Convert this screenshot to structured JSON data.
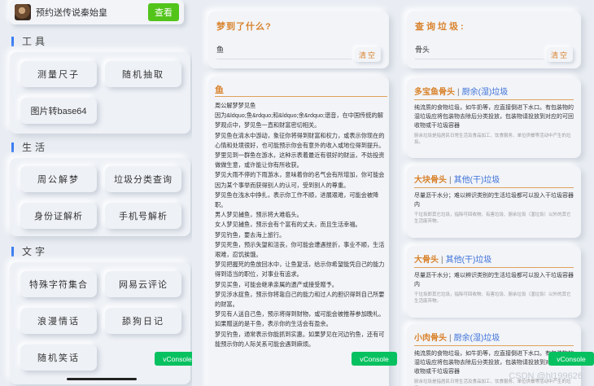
{
  "promo": {
    "text": "预约送传说秦始皇",
    "button": "查看"
  },
  "sections": [
    {
      "title": "工具",
      "items": [
        "测量尺子",
        "随机抽取",
        "图片转base64"
      ]
    },
    {
      "title": "生活",
      "items": [
        "周公解梦",
        "垃圾分类查询",
        "身份证解析",
        "手机号解析"
      ]
    },
    {
      "title": "文字",
      "items": [
        "特殊字符集合",
        "网易云评论",
        "浪漫情话",
        "舔狗日记",
        "随机笑话"
      ]
    }
  ],
  "dream": {
    "title": "梦到了什么?",
    "query": "鱼",
    "clear": "清空",
    "result_title": "鱼",
    "paragraphs": [
      "周公解梦梦见鱼",
      "因为&ldquo;鱼&rdquo;和&ldquo;余&rdquo;谐音，在中国传统的解梦观点中，梦见鱼一直和财富密切相关。",
      "梦见鱼在清水中游动，象征你将得到财富和权力，或表示你现在的心情和处境很好，也可能预示你会有意外的收入或地位得到提升。",
      "梦里见到一群鱼在游水，这种示表着最近有很好的财运，不妨投资做做生意，或许能让你有所收获。",
      "梦见大雨不停的下雨游水，意味着你的名气会有所增加，你可能会因为某个事举而获得别人的认可，受到别人的尊重。",
      "梦见鱼在浅水中挣扎，表示你工作不顺，进展艰难，可能会被降职。",
      "男人梦见捕鱼，预示将大难临头。",
      "女人梦见捕鱼，预示会有个富有的丈夫，而且生活幸福。",
      "梦见钓鱼，要去海上旅行。",
      "梦见死鱼，预示失望和沮丧，你可能会遭遇挫折，事业不顺，生活艰难，忍饥挨饿。",
      "梦见把握死的鱼放回水中，让鱼复活，给示你希望能凭自己的能力得到适当的职位，对事业有追求。",
      "梦见买鱼，可能会继承亲属的遗产或接受赠予。",
      "梦见涉水捉鱼，预示你将靠自己的能力和过人的胆识得到自己所要的财富。",
      "梦见有人送自己鱼，预示将得到财物，或可能会被推荐参加晚礼。如果赠送的是干鱼，表示你的生活会有盈余。",
      "梦见钓鱼，通常表示你能抓到实惠。如果梦见在河边钓鱼，还有可能预示你的人际关系可能会遇到麻烦。"
    ]
  },
  "garbage": {
    "title": "查询垃圾:",
    "query": "骨头",
    "clear": "清空",
    "results": [
      {
        "name": "多宝鱼骨头",
        "sep": "|",
        "category": "厨余(湿)垃圾",
        "desc": "纯流质的食物垃圾，如牛奶等，应直接倒进下水口。有包装物的湿垃圾应将包装物去除后分类投放，包装物请投放到对应的可回收物或干垃圾容器",
        "tip": "厨余垃圾是指居民日常生活及食品加工、饮食服务、单位供餐等活动中产生的垃圾。"
      },
      {
        "name": "大块骨头",
        "sep": "|",
        "category": "其他(干)垃圾",
        "desc": "尽量沥干水分；难以辨识类别的生活垃圾都可以投入干垃圾容器内",
        "tip": "干垃圾即其它垃圾，指除可回收物、有害垃圾、厨余垃圾（湿垃圾）以外的其它生活废弃物。"
      },
      {
        "name": "大骨头",
        "sep": "|",
        "category": "其他(干)垃圾",
        "desc": "尽量沥干水分；难以辨识类别的生活垃圾都可以投入干垃圾容器内",
        "tip": "干垃圾即其它垃圾，指除可回收物、有害垃圾、厨余垃圾（湿垃圾）以外的其它生活废弃物。"
      },
      {
        "name": "小肉骨头",
        "sep": "|",
        "category": "厨余(湿)垃圾",
        "desc": "纯流质的食物垃圾，如牛奶等，应直接倒进下水口。有包装物的湿垃圾应将包装物去除后分类投放，包装物请投放到对应的可回收物或干垃圾容器",
        "tip": "厨余垃圾是指居民日常生活及食品加工、饮食服务、单位供餐等活动中产生的垃圾。"
      }
    ]
  },
  "vconsole": "vConsole",
  "watermark": "CSDN @hl199626"
}
